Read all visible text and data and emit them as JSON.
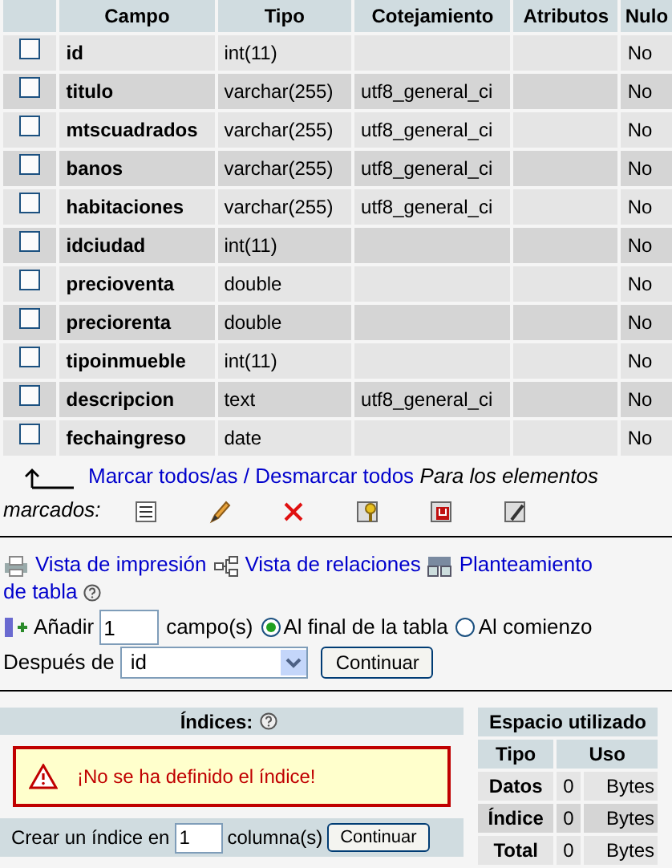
{
  "table": {
    "columns": [
      "Campo",
      "Tipo",
      "Cotejamiento",
      "Atributos",
      "Nulo"
    ],
    "rows": [
      {
        "name": "id",
        "type": "int(11)",
        "null": "No",
        "checked": false
      },
      {
        "name": "titulo",
        "type": "varchar(255)",
        "collation": "utf8_general_ci",
        "null": "No",
        "checked": false
      },
      {
        "name": "mtscuadrados",
        "type": "varchar(255)",
        "collation": "utf8_general_ci",
        "null": "No",
        "checked": false
      },
      {
        "name": "banos",
        "type": "varchar(255)",
        "collation": "utf8_general_ci",
        "null": "No",
        "checked": false
      },
      {
        "name": "habitaciones",
        "type": "varchar(255)",
        "collation": "utf8_general_ci",
        "null": "No",
        "checked": false
      },
      {
        "name": "idciudad",
        "type": "int(11)",
        "null": "No",
        "checked": false
      },
      {
        "name": "precioventa",
        "type": "double",
        "null": "No",
        "checked": false
      },
      {
        "name": "preciorenta",
        "type": "double",
        "null": "No",
        "checked": false
      },
      {
        "name": "tipoinmueble",
        "type": "int(11)",
        "null": "No",
        "checked": false
      },
      {
        "name": "descripcion",
        "type": "text",
        "collation": "utf8_general_ci",
        "null": "No",
        "checked": false
      },
      {
        "name": "fechaingreso",
        "type": "date",
        "null": "No",
        "checked": false
      }
    ]
  },
  "bulk": {
    "check_all": "Marcar todos/as",
    "separator": "/",
    "uncheck_all": "Desmarcar todos",
    "with_selected": [
      "Para los elementos",
      "marcados:"
    ]
  },
  "links": [
    [
      "Vista de impresión"
    ],
    [
      "Vista de relaciones"
    ],
    [
      "Planteamiento",
      "de tabla"
    ]
  ],
  "add_field": {
    "label": "Añadir",
    "count": "1",
    "unit": "campo(s)",
    "positions": [
      {
        "label": "Al final de la tabla",
        "selected": true
      },
      {
        "label": "Al comienzo",
        "selected": false
      }
    ],
    "after_label": "Después de",
    "after_value": "id",
    "button": "Continuar"
  },
  "indexes": {
    "title": "Índices:",
    "warning": "¡No se ha definido el índice!",
    "create_label": "Crear un índice en",
    "count": "1",
    "unit": "columna(s)",
    "button": "Continuar"
  },
  "space": {
    "title": "Espacio utilizado",
    "columns": [
      "Tipo",
      "Uso"
    ],
    "rows": [
      {
        "label": "Datos",
        "value": "0",
        "unit": "Bytes"
      },
      {
        "label": "Índice",
        "value": "0",
        "unit": "Bytes"
      },
      {
        "label": "Total",
        "value": "0",
        "unit": "Bytes"
      }
    ]
  }
}
